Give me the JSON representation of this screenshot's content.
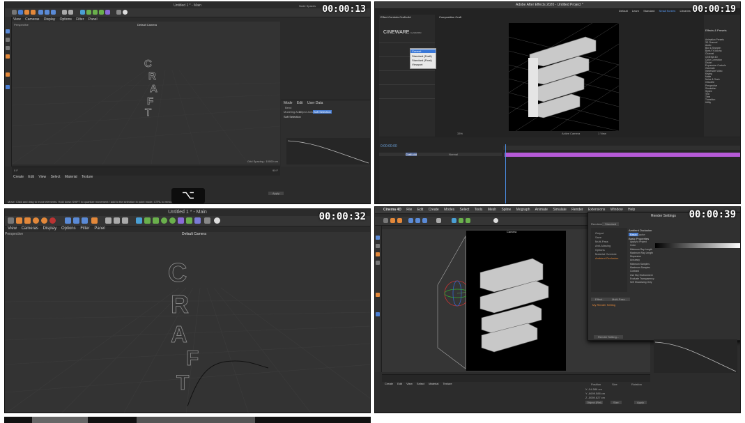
{
  "timestamps": [
    "00:00:13",
    "00:00:19",
    "00:00:32",
    "00:00:39"
  ],
  "panel1": {
    "window_title": "Untitled 1 * - Main",
    "node_spaces": "Node Spaces",
    "menu": [
      "File",
      "Edit",
      "Create",
      "Modes",
      "Select",
      "Tools",
      "Mesh",
      "Spline",
      "Mograph"
    ],
    "viewport_menu": [
      "View",
      "Cameras",
      "Display",
      "Options",
      "Filter",
      "Panel"
    ],
    "camera_label": "Default Camera",
    "viewport_label": "Perspective",
    "letters": [
      "C",
      "R",
      "A",
      "F",
      "T"
    ],
    "attr_tabs": [
      "Mode",
      "Edit",
      "User Data"
    ],
    "attr_title": "Bend",
    "attr_subtabs": [
      "Modeling Axis",
      "Object Axis",
      "Soft Selection"
    ],
    "attr_section": "Soft Selection",
    "bottom_menu": [
      "Create",
      "Edit",
      "View",
      "Select",
      "Material",
      "Texture"
    ],
    "status": "Move: Click and drag to move elements. Hold down SHIFT to quantize movement / add to the selection in point mode, CTRL to remove.",
    "grid_spacing": "Grid Spacing : 10000 cm",
    "apply": "Apply",
    "frame_start": "0 F",
    "frame_end": "90 F",
    "key_hint": "⌥"
  },
  "panel2": {
    "menu": [
      "Adobe After Effects 2020 - Untitled Project *"
    ],
    "workspace": [
      "Default",
      "Learn",
      "Standard",
      "Small Screen",
      "Libraries"
    ],
    "effect_controls": "Effect Controls Craft.c4d",
    "composition": "Composition Craft",
    "cineware_logo": "CINEWARE",
    "cineware_sub": "by MAXON",
    "dropdown_items": [
      "Current",
      "Standard (Draft)",
      "Standard (Final)",
      "Viewport"
    ],
    "dropdown_selected": "Current",
    "right_panel_title": "Effects & Presets",
    "effect_categories": [
      "Animation Presets",
      "3D Channel",
      "Audio",
      "Blur & Sharpen",
      "Boris FX Mocha",
      "Channel",
      "CINEMA 4D",
      "Color Correction",
      "Distort",
      "Expression Controls",
      "Generate",
      "Immersive Video",
      "Keying",
      "Matte",
      "Noise & Grain",
      "Obsolete",
      "Perspective",
      "Simulation",
      "Stylize",
      "Text",
      "Time",
      "Transition",
      "Utility"
    ],
    "zoom": "33%",
    "camera_view": "Active Camera",
    "view_count": "1 View",
    "timecode": "0:00:00:00",
    "layer_name": "Craft.c4d",
    "layer_mode": "Normal"
  },
  "panel3": {
    "window_title": "Untitled 1 * - Main",
    "viewport_menu": [
      "View",
      "Cameras",
      "Display",
      "Options",
      "Filter",
      "Panel"
    ],
    "camera_label": "Default Camera",
    "viewport_label": "Perspective",
    "letters": [
      "C",
      "R",
      "A",
      "F",
      "T"
    ]
  },
  "panel4": {
    "menu": [
      "Cinema 4D",
      "File",
      "Edit",
      "Create",
      "Modes",
      "Select",
      "Tools",
      "Mesh",
      "Spline",
      "Mograph",
      "Animate",
      "Simulate",
      "Render",
      "Extensions",
      "Window",
      "Help"
    ],
    "render_settings_title": "Render Settings",
    "renderer_label": "Renderer",
    "renderer_value": "Standard",
    "settings_list": [
      "Output",
      "Save",
      "Multi-Pass",
      "Anti-Aliasing",
      "Options",
      "Material Override",
      "Ambient Occlusion"
    ],
    "section_title": "Ambient Occlusion",
    "section_tabs": [
      "Basic",
      "Cache"
    ],
    "properties_title": "Basic Properties",
    "properties": [
      "Apply to Project",
      "Color",
      "Minimum Ray Length",
      "Maximum Ray Length",
      "Dispersion",
      "Accuracy",
      "Minimum Samples",
      "Maximum Samples",
      "Contrast",
      "Use Sky Environment",
      "Evaluate Transparency",
      "Self Shadowing Only"
    ],
    "effect_button": "Effect...",
    "multipass_button": "Multi-Pass...",
    "my_render_setting": "My Render Setting",
    "render_setting_button": "Render Setting...",
    "camera_label": "Camera",
    "grid_spacing": "Grid Spacing : 1000 cm",
    "bottom_menu": [
      "Create",
      "Edit",
      "View",
      "Select",
      "Material",
      "Texture"
    ],
    "coord_headers": [
      "Position",
      "Size",
      "Rotation"
    ],
    "coords": [
      "X  -54.586 cm",
      "Y  -6699.588 cm",
      "Z  -5059.627 cm"
    ],
    "object_rel": "Object (Rel)",
    "size_label": "Size",
    "apply": "Apply"
  },
  "colors": {
    "panel_bg": "#2b2b2b",
    "viewport_bg": "#333333",
    "accent_blue": "#4a7fd4",
    "ae_purple": "#b55ad6",
    "c4d_orange": "#e3883a"
  }
}
